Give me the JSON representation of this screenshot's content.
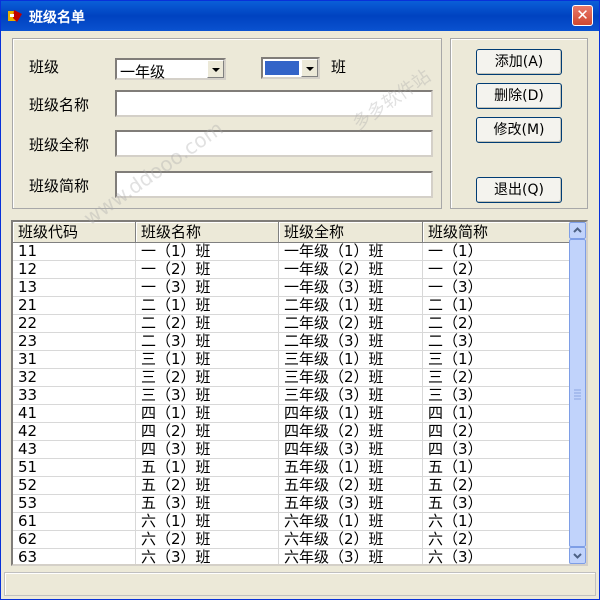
{
  "window": {
    "title": "班级名单",
    "close_glyph": "✕"
  },
  "form": {
    "class_label": "班级",
    "class_selected": "一年级",
    "class_suffix": "班",
    "name_label": "班级名称",
    "name_value": "",
    "fullname_label": "班级全称",
    "fullname_value": "",
    "shortname_label": "班级简称",
    "shortname_value": ""
  },
  "buttons": {
    "add": "添加(A)",
    "delete": "删除(D)",
    "modify": "修改(M)",
    "exit": "退出(Q)"
  },
  "colors": {
    "title_bar": "#0a5fd8",
    "swatch": "#3364c8"
  },
  "table": {
    "columns": [
      "班级代码",
      "班级名称",
      "班级全称",
      "班级简称"
    ],
    "rows": [
      [
        "11",
        "一（1）班",
        "一年级（1）班",
        "一（1）"
      ],
      [
        "12",
        "一（2）班",
        "一年级（2）班",
        "一（2）"
      ],
      [
        "13",
        "一（3）班",
        "一年级（3）班",
        "一（3）"
      ],
      [
        "21",
        "二（1）班",
        "二年级（1）班",
        "二（1）"
      ],
      [
        "22",
        "二（2）班",
        "二年级（2）班",
        "二（2）"
      ],
      [
        "23",
        "二（3）班",
        "二年级（3）班",
        "二（3）"
      ],
      [
        "31",
        "三（1）班",
        "三年级（1）班",
        "三（1）"
      ],
      [
        "32",
        "三（2）班",
        "三年级（2）班",
        "三（2）"
      ],
      [
        "33",
        "三（3）班",
        "三年级（3）班",
        "三（3）"
      ],
      [
        "41",
        "四（1）班",
        "四年级（1）班",
        "四（1）"
      ],
      [
        "42",
        "四（2）班",
        "四年级（2）班",
        "四（2）"
      ],
      [
        "43",
        "四（3）班",
        "四年级（3）班",
        "四（3）"
      ],
      [
        "51",
        "五（1）班",
        "五年级（1）班",
        "五（1）"
      ],
      [
        "52",
        "五（2）班",
        "五年级（2）班",
        "五（2）"
      ],
      [
        "53",
        "五（3）班",
        "五年级（3）班",
        "五（3）"
      ],
      [
        "61",
        "六（1）班",
        "六年级（1）班",
        "六（1）"
      ],
      [
        "62",
        "六（2）班",
        "六年级（2）班",
        "六（2）"
      ],
      [
        "63",
        "六（3）班",
        "六年级（3）班",
        "六（3）"
      ]
    ]
  },
  "watermarks": [
    "www.ddooo.com",
    "多多软件站"
  ]
}
